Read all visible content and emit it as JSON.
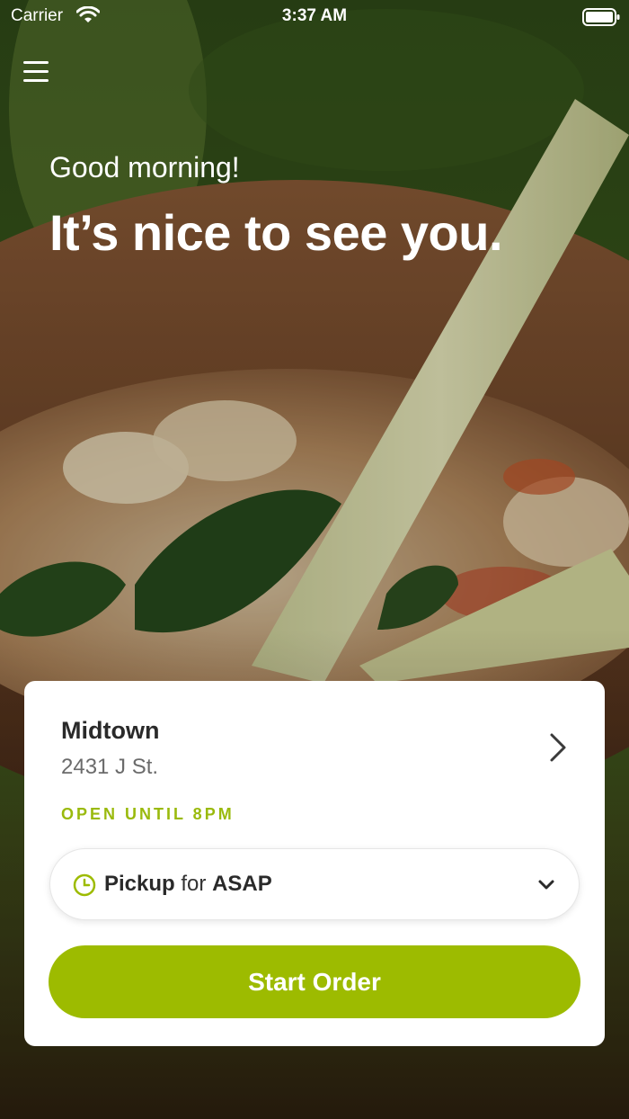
{
  "status_bar": {
    "carrier": "Carrier",
    "time": "3:37 AM"
  },
  "hero": {
    "greeting": "Good morning!",
    "headline": "It’s nice to see you."
  },
  "location": {
    "name": "Midtown",
    "address": "2431 J St.",
    "hours": "OPEN UNTIL 8PM"
  },
  "order_mode": {
    "mode": "Pickup",
    "connector": "for",
    "time": "ASAP"
  },
  "start_button": {
    "label": "Start Order"
  },
  "colors": {
    "accent": "#9dbb00",
    "hours_text": "#9aba0d",
    "card_bg": "#ffffff"
  },
  "icons": [
    "wifi-icon",
    "battery-icon",
    "hamburger-menu-icon",
    "chevron-right-icon",
    "clock-icon",
    "chevron-down-icon"
  ]
}
